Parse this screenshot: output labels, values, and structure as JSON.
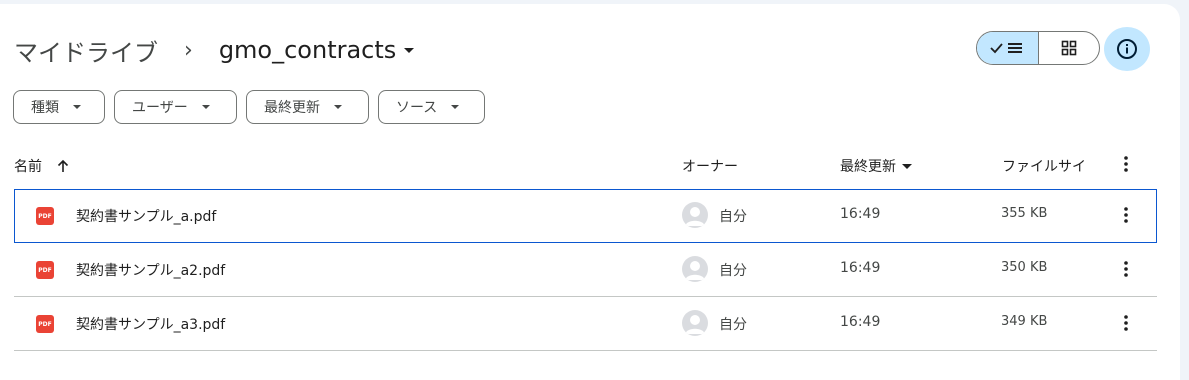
{
  "breadcrumb": {
    "root": "マイドライブ",
    "separator": "›",
    "current": "gmo_contracts"
  },
  "toolbar": {
    "view_icons": [
      "check-icon",
      "list-icon",
      "grid-icon"
    ],
    "info_icon": "info-icon"
  },
  "filters": [
    {
      "label": "種類"
    },
    {
      "label": "ユーザー"
    },
    {
      "label": "最終更新"
    },
    {
      "label": "ソース"
    }
  ],
  "columns": {
    "name": "名前",
    "owner": "オーナー",
    "modified": "最終更新",
    "size": "ファイルサイ"
  },
  "files": [
    {
      "name": "契約書サンプル_a.pdf",
      "icon": "PDF",
      "owner": "自分",
      "modified": "16:49",
      "size": "355 KB",
      "selected": true
    },
    {
      "name": "契約書サンプル_a2.pdf",
      "icon": "PDF",
      "owner": "自分",
      "modified": "16:49",
      "size": "350 KB",
      "selected": false
    },
    {
      "name": "契約書サンプル_a3.pdf",
      "icon": "PDF",
      "owner": "自分",
      "modified": "16:49",
      "size": "349 KB",
      "selected": false
    }
  ],
  "colors": {
    "accent": "#c2e7ff",
    "selection_border": "#0b57d0",
    "pdf_red": "#ea4335"
  }
}
